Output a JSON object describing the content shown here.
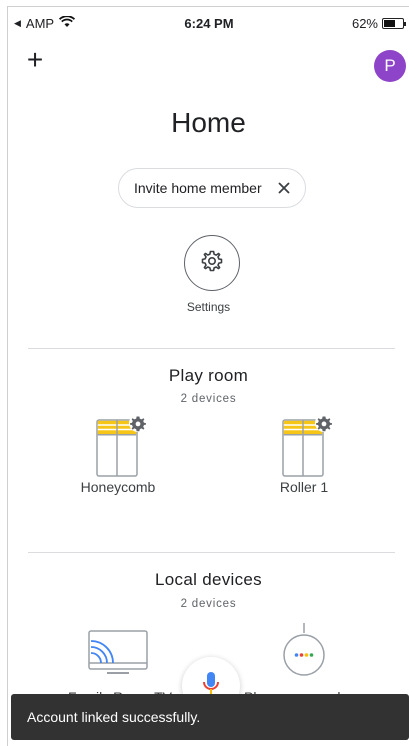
{
  "statusbar": {
    "back_label": "AMP",
    "time": "6:24 PM",
    "battery_text": "62%",
    "battery_level": 0.62
  },
  "header": {
    "add_label": "+",
    "avatar_letter": "P",
    "avatar_color": "#8e44c8"
  },
  "home": {
    "title": "Home",
    "invite_chip_label": "Invite home member",
    "settings_label": "Settings"
  },
  "sections": [
    {
      "title": "Play room",
      "subtitle": "2 devices",
      "devices": [
        {
          "name": "Honeycomb",
          "icon": "blinds-settings-icon"
        },
        {
          "name": "Roller 1",
          "icon": "blinds-settings-icon"
        }
      ]
    },
    {
      "title": "Local devices",
      "subtitle": "2 devices",
      "devices": [
        {
          "name": "Family Room TV",
          "icon": "cast-tv-icon"
        },
        {
          "name": "Playroom speaker",
          "icon": "smart-speaker-icon"
        }
      ]
    }
  ],
  "fab": {
    "icon": "microphone-icon"
  },
  "snackbar": {
    "message": "Account linked successfully."
  },
  "colors": {
    "accent_yellow": "#f5c518",
    "divider": "#dadce0",
    "snackbar_bg": "#323232",
    "mic_blue": "#4285f4",
    "mic_red": "#ea4335"
  }
}
